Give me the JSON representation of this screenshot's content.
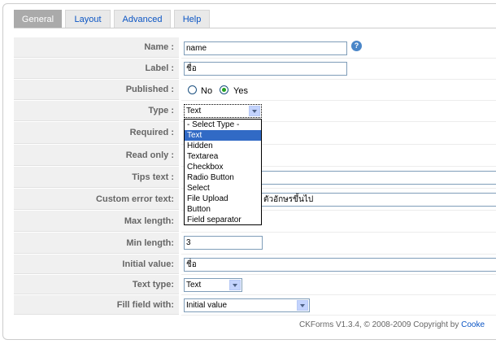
{
  "tabs": [
    {
      "label": "General",
      "active": true
    },
    {
      "label": "Layout",
      "active": false
    },
    {
      "label": "Advanced",
      "active": false
    },
    {
      "label": "Help",
      "active": false
    }
  ],
  "fields": {
    "name": {
      "label": "Name :",
      "value": "name"
    },
    "label": {
      "label": "Label :",
      "value": "ชื่อ"
    },
    "published": {
      "label": "Published :",
      "options": [
        "No",
        "Yes"
      ],
      "selected": "Yes"
    },
    "type": {
      "label": "Type :",
      "value": "Text"
    },
    "required": {
      "label": "Required :"
    },
    "readonly": {
      "label": "Read only :"
    },
    "tips": {
      "label": "Tips text :",
      "value": ""
    },
    "custom_error": {
      "label": "Custom error text:",
      "value": "ตัวอักษรขึ้นไป"
    },
    "max_length": {
      "label": "Max length:"
    },
    "min_length": {
      "label": "Min length:",
      "value": "3"
    },
    "initial_value": {
      "label": "Initial value:",
      "value": "ชื่อ"
    },
    "text_type": {
      "label": "Text type:",
      "value": "Text"
    },
    "fill_field": {
      "label": "Fill field with:",
      "value": "Initial value"
    }
  },
  "type_dropdown": {
    "options": [
      "- Select Type -",
      "Text",
      "Hidden",
      "Textarea",
      "Checkbox",
      "Radio Button",
      "Select",
      "File Upload",
      "Button",
      "Field separator"
    ],
    "highlighted": "Text"
  },
  "help_icon": "help-icon",
  "footer": {
    "text": "CKForms V1.3.4, © 2008-2009 Copyright by ",
    "link": "Cooke"
  },
  "colors": {
    "tab_active": "#aaaaaa",
    "label_bg": "#f0f0f0",
    "link": "#0b55c4",
    "highlight": "#316ac5"
  }
}
